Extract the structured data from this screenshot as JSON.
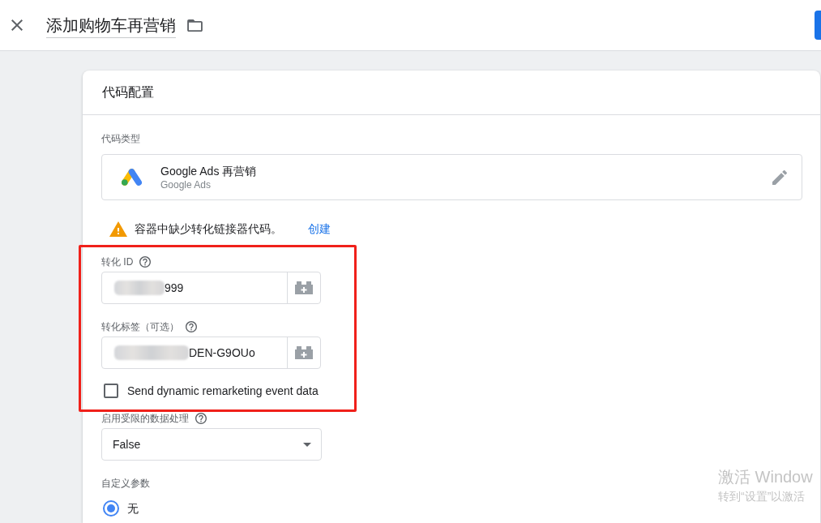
{
  "header": {
    "title": "添加购物车再营销"
  },
  "card": {
    "title": "代码配置",
    "tag_type": {
      "label": "代码类型",
      "name": "Google Ads 再营销",
      "vendor": "Google Ads"
    },
    "warning": {
      "message": "容器中缺少转化链接器代码。",
      "link": "创建"
    },
    "fields": [
      {
        "kind": "text",
        "label": "转化 ID",
        "help": true,
        "value": "999",
        "redacted": true,
        "highlighted": true
      },
      {
        "kind": "text",
        "label": "转化标签（可选）",
        "help": true,
        "value": "DEN-G9OUo",
        "redacted": true,
        "highlighted": true
      },
      {
        "kind": "checkbox",
        "label": "Send dynamic remarketing event data",
        "checked": false,
        "highlighted": true
      },
      {
        "kind": "select",
        "label": "启用受限的数据处理",
        "help": true,
        "value": "False",
        "highlighted": false
      },
      {
        "kind": "radio_group",
        "label": "自定义参数",
        "options": [
          {
            "label": "无",
            "selected": true
          }
        ],
        "highlighted": false
      }
    ]
  },
  "activation_notice": {
    "title": "激活 Window",
    "text": "转到“设置”以激活"
  }
}
